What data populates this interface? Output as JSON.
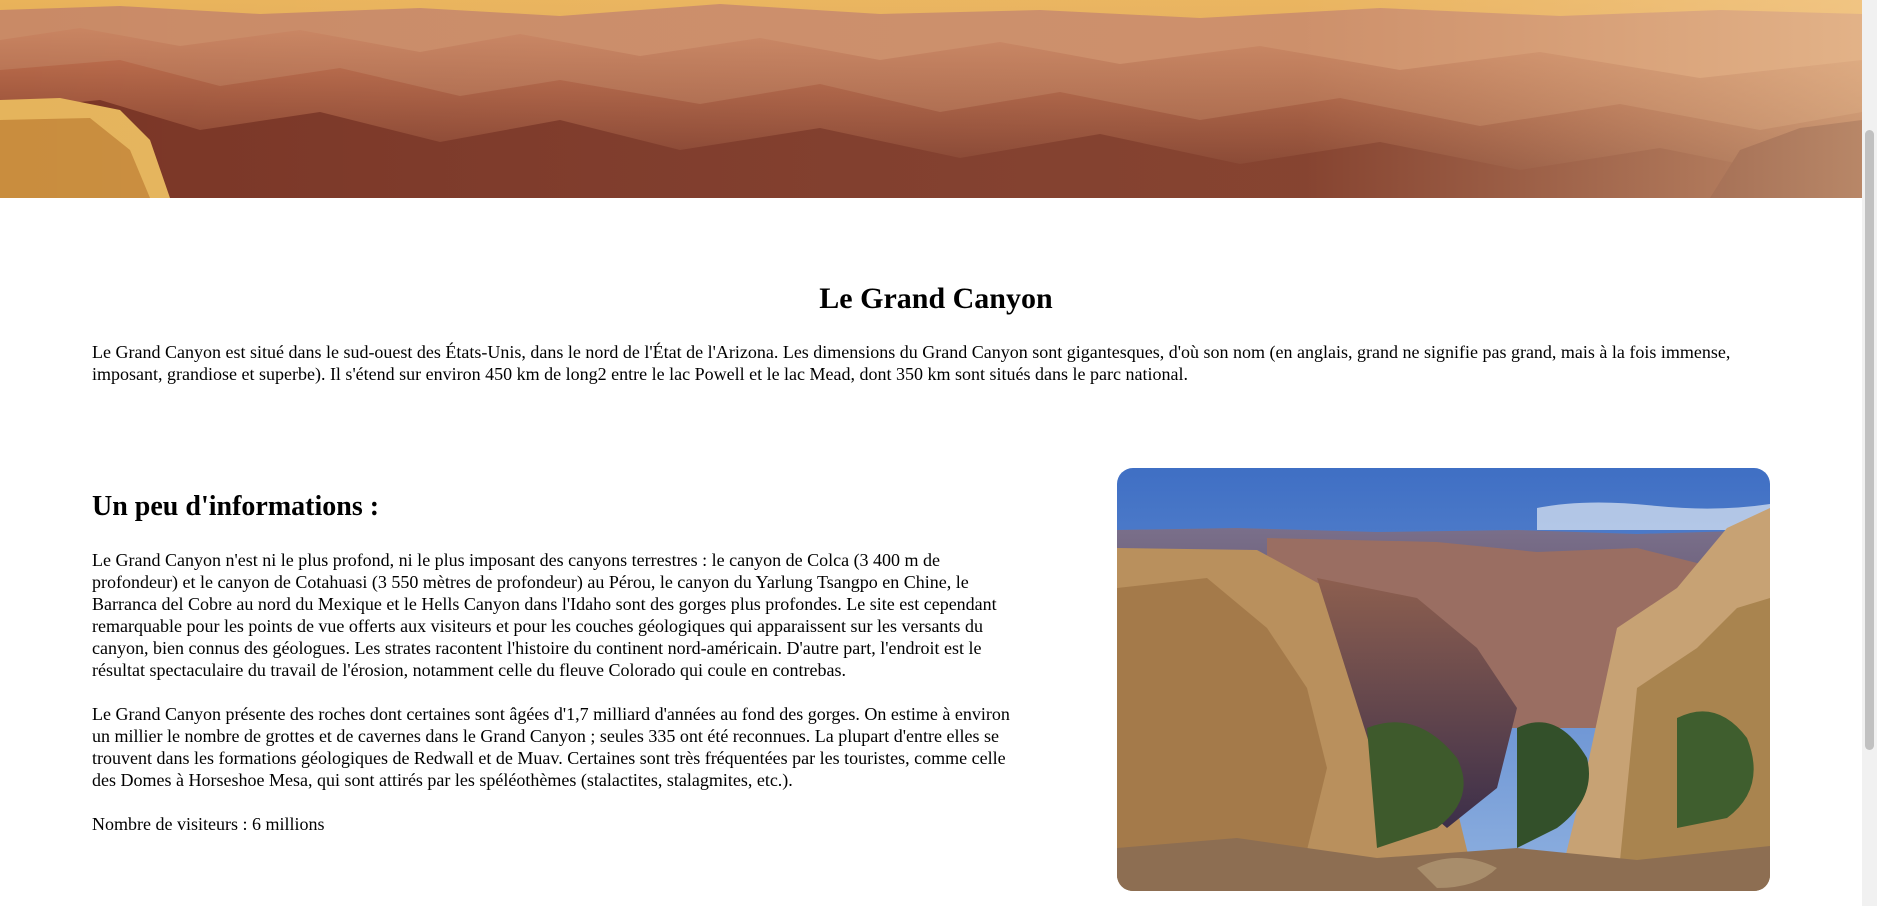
{
  "banner": {
    "image": "grand-canyon-sunset-panorama"
  },
  "title": "Le Grand Canyon",
  "intro": "Le Grand Canyon est situé dans le sud-ouest des États-Unis, dans le nord de l'État de l'Arizona. Les dimensions du Grand Canyon sont gigantesques, d'où son nom (en anglais, grand ne signifie pas grand, mais à la fois immense, imposant, grandiose et superbe). Il s'étend sur environ 450 km de long2 entre le lac Powell et le lac Mead, dont 350 km sont situés dans le parc national.",
  "info": {
    "heading": "Un peu d'informations :",
    "paragraph1": "Le Grand Canyon n'est ni le plus profond, ni le plus imposant des canyons terrestres : le canyon de Colca (3 400 m de profondeur) et le canyon de Cotahuasi (3 550 mètres de profondeur) au Pérou, le canyon du Yarlung Tsangpo en Chine, le Barranca del Cobre au nord du Mexique et le Hells Canyon dans l'Idaho sont des gorges plus profondes. Le site est cependant remarquable pour les points de vue offerts aux visiteurs et pour les couches géologiques qui apparaissent sur les versants du canyon, bien connus des géologues. Les strates racontent l'histoire du continent nord-américain. D'autre part, l'endroit est le résultat spectaculaire du travail de l'érosion, notamment celle du fleuve Colorado qui coule en contrebas.",
    "paragraph2": "Le Grand Canyon présente des roches dont certaines sont âgées d'1,7 milliard d'années au fond des gorges. On estime à environ un millier le nombre de grottes et de cavernes dans le Grand Canyon ; seules 335 ont été reconnues. La plupart d'entre elles se trouvent dans les formations géologiques de Redwall et de Muav. Certaines sont très fréquentées par les touristes, comme celle des Domes à Horseshoe Mesa, qui sont attirés par les spéléothèmes (stalactites, stalagmites, etc.).",
    "visitors": "Nombre de visiteurs : 6 millions"
  },
  "photo": {
    "image": "grand-canyon-daytime-view"
  }
}
